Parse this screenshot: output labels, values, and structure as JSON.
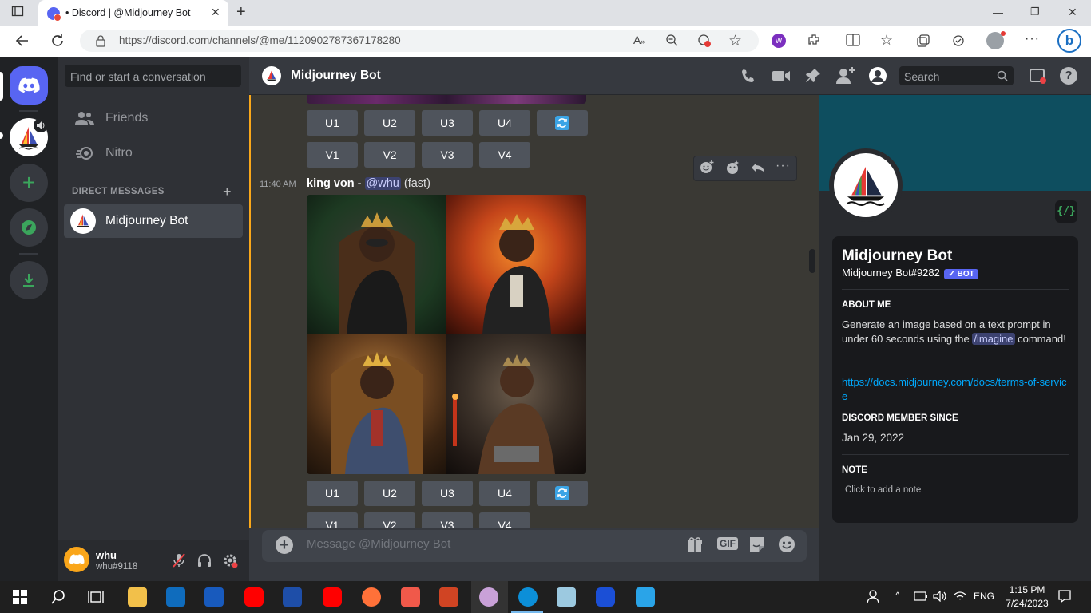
{
  "browser": {
    "tab_title": "• Discord | @Midjourney Bot",
    "url": "https://discord.com/channels/@me/1120902787367178280",
    "window_controls": [
      "—",
      "❐",
      "✕"
    ]
  },
  "dm_panel": {
    "search_placeholder": "Find or start a conversation",
    "nav": [
      {
        "label": "Friends",
        "icon": "friends-icon"
      },
      {
        "label": "Nitro",
        "icon": "nitro-icon"
      }
    ],
    "direct_messages_header": "DIRECT MESSAGES",
    "dms": [
      {
        "label": "Midjourney Bot"
      }
    ]
  },
  "user": {
    "name": "whu",
    "tag": "whu#9118"
  },
  "chat": {
    "channel_name": "Midjourney Bot",
    "search_placeholder": "Search",
    "upscale_buttons": [
      "U1",
      "U2",
      "U3",
      "U4"
    ],
    "variation_buttons": [
      "V1",
      "V2",
      "V3",
      "V4"
    ],
    "message": {
      "time": "11:40 AM",
      "prompt": "king von",
      "separator": " - ",
      "mention": "@whu",
      "mode": "(fast)"
    },
    "composer_placeholder": "Message @Midjourney Bot",
    "composer_gif": "GIF"
  },
  "profile": {
    "name": "Midjourney Bot",
    "tag": "Midjourney Bot#9282",
    "badge": "✓ BOT",
    "about_header": "ABOUT ME",
    "about_text_1": "Generate an image based on a text prompt in under 60 seconds using the",
    "about_command": "/imagine",
    "about_text_2": "command!",
    "link": "https://docs.midjourney.com/docs/terms-of-service",
    "member_since_header": "DISCORD MEMBER SINCE",
    "member_since": "Jan 29, 2022",
    "note_header": "NOTE",
    "note_placeholder": "Click to add a note",
    "code_badge": "{/}"
  },
  "taskbar": {
    "language": "ENG",
    "time": "1:15 PM",
    "date": "7/24/2023"
  },
  "colors": {
    "accent": "#5865f2",
    "guild_bg": "#202225",
    "link": "#00a8fc",
    "mention_bg": "#3c4270"
  }
}
